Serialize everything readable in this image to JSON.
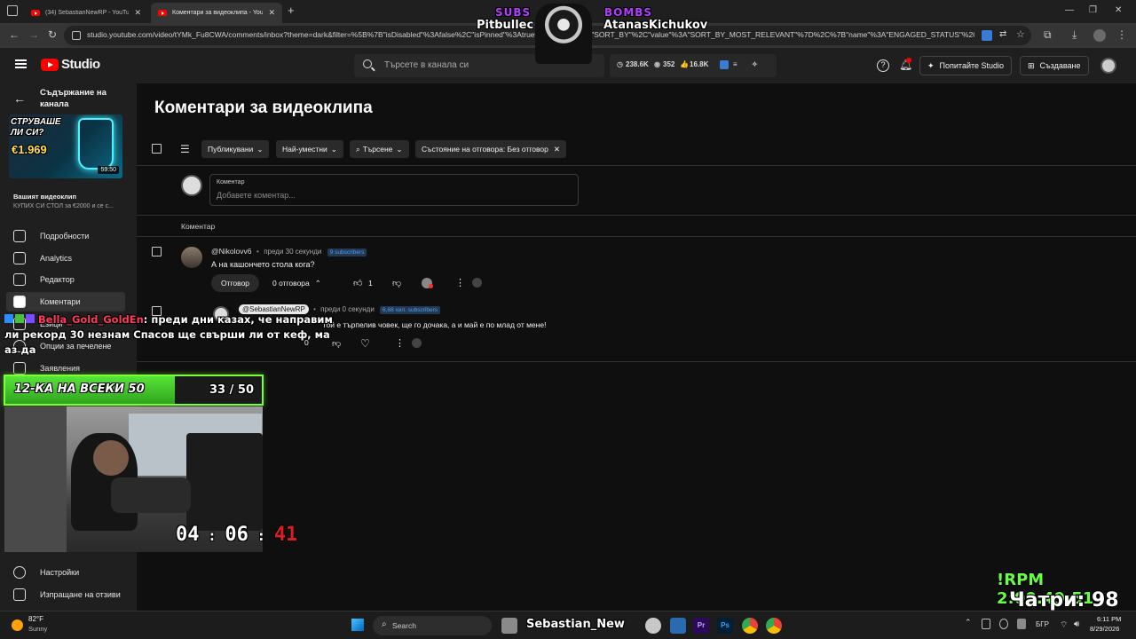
{
  "browser": {
    "tabs": [
      {
        "title": "(34) SebastianNewRP - YouTube"
      },
      {
        "title": "Коментари за видеоклипа - YouTube"
      }
    ],
    "new_tab": "+",
    "url": "studio.youtube.com/video/tYMk_Fu8CWA/comments/inbox?theme=dark&filter=%5B%7B\"isDisabled\"%3Afalse%2C\"isPinned\"%3Atrue%2C\"name\"%3A\"SORT_BY\"%2C\"value\"%3A\"SORT_BY_MOST_RELEVANT\"%7D%2C%7B\"name\"%3A\"ENGAGED_STATUS\"%2C\"v..."
  },
  "studio": {
    "logo": "Studio",
    "search_placeholder": "Търсете в канала си",
    "stats": {
      "subs": "238.6K",
      "views": "352",
      "likes": "16.8K"
    },
    "ask_studio": "Попитайте Studio",
    "create": "Създаване"
  },
  "sidebar": {
    "back_label": "Съдържание на канала",
    "video_label": "Вашият видеоклип",
    "video_title": "КУПИХ СИ СТОЛ за €2000 и се с...",
    "thumb_text": "СТРУВАШЕ ЛИ СИ?",
    "thumb_price": "€1.969",
    "duration": "59:50",
    "items": [
      {
        "label": "Подробности"
      },
      {
        "label": "Analytics"
      },
      {
        "label": "Редактор"
      },
      {
        "label": "Коментари"
      },
      {
        "label": "Езици"
      },
      {
        "label": "Опции за печелене"
      },
      {
        "label": "Заявления"
      }
    ],
    "settings": "Настройки",
    "feedback": "Изпращане на отзиви"
  },
  "main": {
    "title": "Коментари за видеоклипа",
    "filters": [
      "Публикувани",
      "Най-уместни",
      "Търсене",
      "Състояние на отговора: Без отговор"
    ],
    "compose": {
      "label": "Коментар",
      "placeholder": "Добавете коментар..."
    },
    "column_header": "Коментар",
    "comments": [
      {
        "author": "@Nikolovv6",
        "time": "преди 30 секунди",
        "subs_badge": "9 subscribers",
        "text": "А на кашончето стола кога?",
        "reply_label": "Отговор",
        "replies_label": "0 отговора",
        "likes": "1"
      },
      {
        "author": "@SebastianNewRP",
        "time": "преди 0 секунди",
        "subs_badge": "6,68 хил. subscribers",
        "text": "Той е търпелив човек, ще го дочака, а и май е по млад от мене!",
        "likes": "0"
      }
    ]
  },
  "overlays": {
    "subs_label": "SUBS",
    "subs_name": "Pitbullec",
    "bombs_label": "BOMBS",
    "bombs_name": "AtanasKichukov",
    "chat_user": "Bella_Gold_GoldEn",
    "chat_text": ": преди дни казах, че направим ли рекорд 30 незнам Спасов ще свърши ли от кеф, ма аз да",
    "goal_label": "12-КА НА ВСЕКИ 50",
    "goal_count": "33 / 50",
    "goal_progress": 0.66,
    "timer_hh": "04",
    "timer_mm": "06",
    "timer_ss": "41",
    "rpm": "!RPM 2:00:49:51",
    "chatri": "Чатри: 98"
  },
  "taskbar": {
    "weather_temp": "82°F",
    "weather_desc": "Sunny",
    "search": "Search",
    "app_label": "Sebastian_New",
    "lang": "БГР",
    "time": "6:11 PM",
    "date": "8/29/2026"
  },
  "colors": {
    "accent_red": "#ff0000",
    "goal_green": "#57e436",
    "rpm_green": "#66ff44",
    "badge_blue": "#3ea6ff"
  }
}
